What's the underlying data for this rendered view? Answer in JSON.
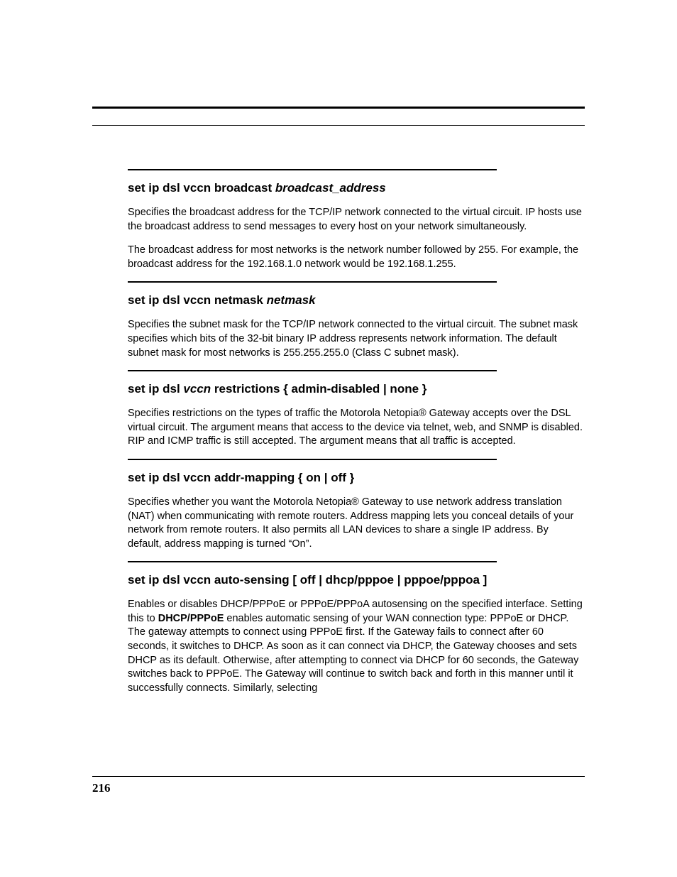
{
  "page_number": "216",
  "sections": [
    {
      "heading_prefix": "set ip dsl vccn broadcast ",
      "heading_italic": "broadcast_address",
      "heading_suffix": "",
      "paragraphs": [
        "Specifies the broadcast address for the TCP/IP network connected to the virtual circuit. IP hosts use the broadcast address to send messages to every host on your network simultaneously.",
        "The broadcast address for most networks is the network number followed by 255. For example, the broadcast address for the 192.168.1.0 network would be 192.168.1.255."
      ]
    },
    {
      "heading_prefix": "set ip dsl vccn netmask ",
      "heading_italic": "netmask",
      "heading_suffix": "",
      "paragraphs": [
        "Specifies the subnet mask for the TCP/IP network connected to the virtual circuit. The subnet mask specifies which bits of the 32-bit binary IP address represents network information. The default subnet mask for most networks is 255.255.255.0 (Class C subnet mask)."
      ]
    },
    {
      "heading_prefix": "set ip dsl ",
      "heading_italic": "vccn",
      "heading_suffix": " restrictions { admin-disabled | none }",
      "paragraphs": [
        "Specifies restrictions on the types of traffic the Motorola Netopia® Gateway accepts over the DSL virtual circuit. The                                  argument means that access to the device via telnet, web, and SNMP is disabled. RIP and ICMP traffic is still accepted. The               argument means that all traffic is accepted."
      ]
    },
    {
      "heading_prefix": "set ip dsl vccn addr-mapping { on | off }",
      "heading_italic": "",
      "heading_suffix": "",
      "paragraphs": [
        "Specifies whether you want the Motorola Netopia® Gateway to use network address translation (NAT) when communicating with remote routers. Address mapping lets you conceal details of your network from remote routers. It also permits all LAN devices to share a single IP address. By default, address mapping is turned “On”."
      ]
    },
    {
      "heading_prefix": "set ip dsl vccn auto-sensing [ off | dhcp/pppoe | pppoe/pppoa ]",
      "heading_italic": "",
      "heading_suffix": "",
      "special_paragraph": {
        "pre": "Enables or disables DHCP/PPPoE or PPPoE/PPPoA autosensing on the specified interface. Setting this to ",
        "bold": "DHCP/PPPoE",
        "post": " enables automatic sensing of your WAN connection type: PPPoE or DHCP. The gateway attempts to connect using PPPoE first. If the Gateway fails to connect after 60 seconds, it switches to DHCP. As soon as it can connect via DHCP, the Gateway chooses and sets DHCP as its default. Otherwise, after attempting to connect via DHCP for 60 seconds, the Gateway switches back to PPPoE. The Gateway will continue to switch back and forth in this manner until it successfully connects. Similarly, selecting"
      }
    }
  ]
}
